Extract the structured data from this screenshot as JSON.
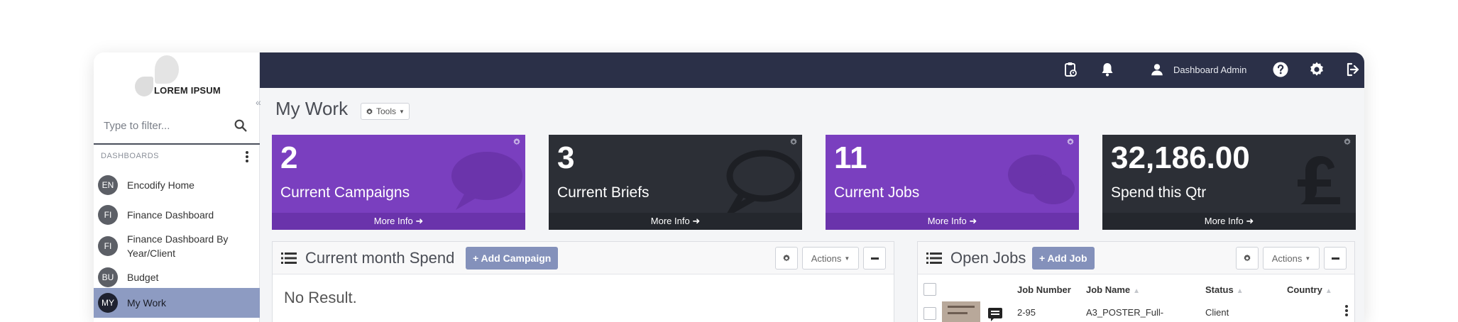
{
  "brand": {
    "logo_text": "LOREM IPSUM"
  },
  "sidebar": {
    "collapse_glyph": "«",
    "filter_placeholder": "Type to filter...",
    "section_title": "DASHBOARDS",
    "items": [
      {
        "initials": "EN",
        "label": "Encodify Home"
      },
      {
        "initials": "FI",
        "label": "Finance Dashboard"
      },
      {
        "initials": "FI",
        "label": "Finance Dashboard By Year/Client"
      },
      {
        "initials": "BU",
        "label": "Budget"
      },
      {
        "initials": "MY",
        "label": "My Work",
        "active": true
      }
    ]
  },
  "topbar": {
    "user_label": "Dashboard Admin",
    "icons": [
      "clipboard-icon",
      "bell-icon",
      "user-icon",
      "help-icon",
      "gear-icon",
      "logout-icon"
    ]
  },
  "page": {
    "title": "My Work",
    "tools_label": "Tools"
  },
  "tiles": [
    {
      "value": "2",
      "caption": "Current Campaigns",
      "more": "More Info",
      "color": "#7a3fbf",
      "bg_icon": "speech-bubble-icon"
    },
    {
      "value": "3",
      "caption": "Current Briefs",
      "more": "More Info",
      "color": "#2c2f36",
      "bg_icon": "speech-bubble-icon"
    },
    {
      "value": "11",
      "caption": "Current Jobs",
      "more": "More Info",
      "color": "#7a3fbf",
      "bg_icon": "speech-bubbles-icon"
    },
    {
      "value": "32,186.00",
      "caption": "Spend this Qtr",
      "more": "More Info",
      "color": "#2c2f36",
      "bg_icon": "pound-icon"
    }
  ],
  "spend_panel": {
    "title": "Current month Spend",
    "add_label": "+ Add Campaign",
    "actions_label": "Actions",
    "empty_text": "No Result."
  },
  "jobs_panel": {
    "title": "Open Jobs",
    "add_label": "+ Add Job",
    "actions_label": "Actions",
    "columns": [
      "Job Number",
      "Job Name",
      "Status",
      "Country"
    ],
    "rows": [
      {
        "job_number": "2-95",
        "job_name": "A3_POSTER_Full-",
        "status": "Client",
        "country": ""
      }
    ]
  }
}
